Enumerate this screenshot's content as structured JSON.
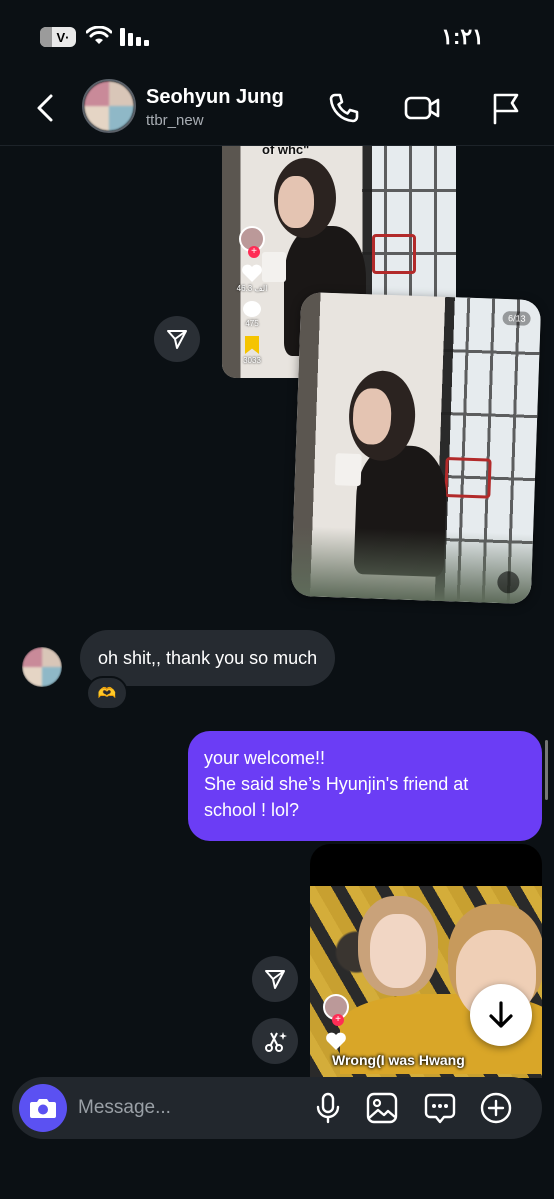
{
  "status_bar": {
    "carrier": "V·",
    "time": "١:٢١"
  },
  "header": {
    "name": "Seohyun Jung",
    "handle": "ttbr_new"
  },
  "messages": {
    "post1": {
      "caption": "of whc\"",
      "likes": "46.3 الف",
      "comments": "475",
      "saves": "3033"
    },
    "post2": {
      "page_indicator": "6/13"
    },
    "incoming_text": "oh shit,, thank you so much",
    "reaction": "🫶",
    "outgoing_lines": [
      "your welcome!!",
      "She said she’s Hyunjin's friend at",
      "school ! lol?"
    ],
    "post3": {
      "subtitle": "Wrong(I was Hwang"
    }
  },
  "composer": {
    "placeholder": "Message..."
  },
  "colors": {
    "background": "#0b1014",
    "outgoing_bubble": "#6b3df5",
    "incoming_bubble": "#262b31",
    "camera_button": "#5b51f2"
  }
}
